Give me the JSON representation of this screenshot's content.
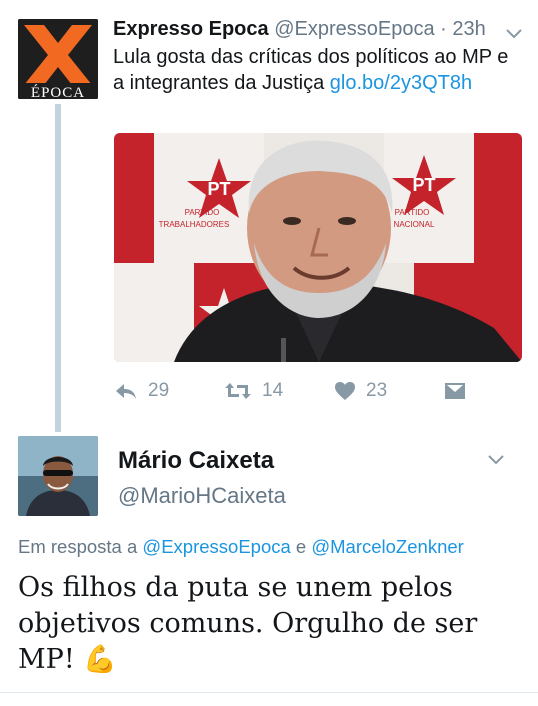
{
  "parent_tweet": {
    "avatar_text": "ÉPOCA",
    "display_name": "Expresso Epoca",
    "handle": "@ExpressoEpoca",
    "separator": "·",
    "time": "23h",
    "text": "Lula gosta das críticas dos políticos ao MP e a integrantes da Justiça ",
    "link": "glo.bo/2y3QT8h",
    "photo": {
      "banner_words": [
        "PT",
        "PARTIDO",
        "TRABALHADORES",
        "PARTIDO",
        "NACIONAL"
      ]
    },
    "actions": {
      "reply_icon": "reply-icon",
      "reply_count": "29",
      "retweet_icon": "retweet-icon",
      "retweet_count": "14",
      "like_icon": "heart-icon",
      "like_count": "23",
      "dm_icon": "direct-message-icon"
    }
  },
  "reply_tweet": {
    "display_name": "Mário Caixeta",
    "handle": "@MarioHCaixeta",
    "in_reply_to_prefix": "Em resposta a ",
    "mention_1": "@ExpressoEpoca",
    "conjunction": " e ",
    "mention_2": "@MarceloZenkner",
    "text": "Os filhos da puta se unem pelos objetivos comuns. Orgulho de ser MP! 💪"
  },
  "colors": {
    "link": "#1b95e0",
    "secondary_text": "#657786",
    "icon_gray": "#8899a6",
    "thread_line": "#c4d2dc",
    "epoca_orange": "#f26a21"
  }
}
